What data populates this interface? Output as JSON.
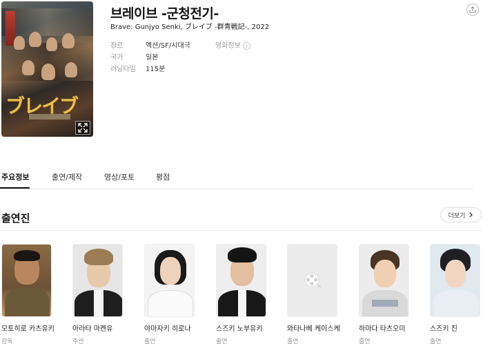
{
  "movie": {
    "title": "브레이브 -군청전기-",
    "subtitle": "Brave: Gunjyo Senki, ブレイブ -群青戦記-, 2022",
    "poster_title_art": "ブレイブ"
  },
  "info": [
    {
      "label": "장르",
      "value": "액션/SF/시대극",
      "extra": "영화정보"
    },
    {
      "label": "국가",
      "value": "일본"
    },
    {
      "label": "러닝타임",
      "value": "115분"
    }
  ],
  "tabs": [
    {
      "label": "주요정보",
      "active": true
    },
    {
      "label": "출연/제작"
    },
    {
      "label": "영상/포토"
    },
    {
      "label": "평점"
    }
  ],
  "cast_section": {
    "title": "출연진",
    "more_label": "더보기"
  },
  "cast": [
    {
      "name": "모토히로 카츠유키",
      "role": "감독"
    },
    {
      "name": "아라타 마켄유",
      "role": "주연"
    },
    {
      "name": "야마자키 히로나",
      "role": "출연"
    },
    {
      "name": "스즈키 노부유키",
      "role": "출연"
    },
    {
      "name": "와타나베 케이스케",
      "role": "출연"
    },
    {
      "name": "하마다 타츠오미",
      "role": "출연"
    },
    {
      "name": "스즈키 진",
      "role": "출연"
    }
  ],
  "icons": {
    "share": "share-icon",
    "expand": "expand-icon",
    "info": "info-icon",
    "chevron": "chevron-right-icon",
    "film": "film-reel-icon"
  }
}
